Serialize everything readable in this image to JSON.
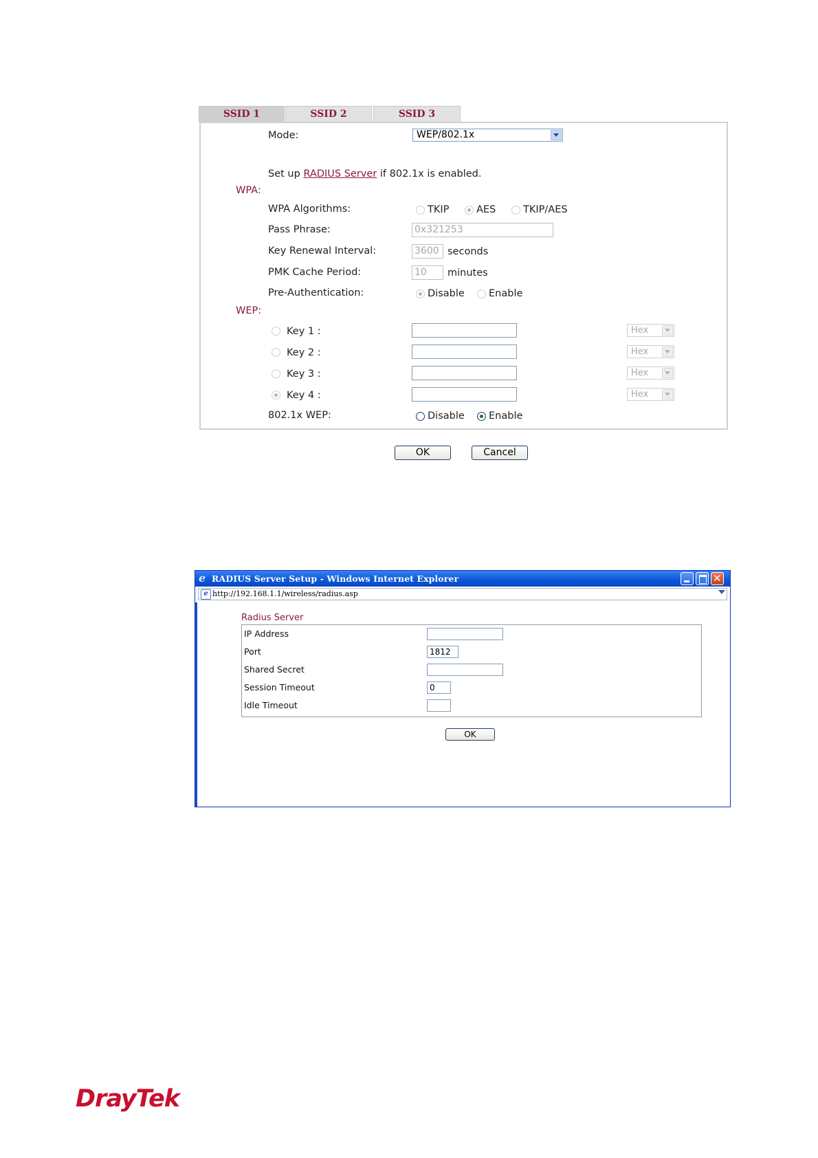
{
  "tabs": [
    {
      "label": "SSID 1"
    },
    {
      "label": "SSID 2"
    },
    {
      "label": "SSID 3"
    }
  ],
  "mode": {
    "label": "Mode:",
    "value": "WEP/802.1x"
  },
  "radius_note": {
    "prefix": "Set up",
    "link": "RADIUS Server",
    "suffix": "if 802.1x is enabled."
  },
  "wpa": {
    "title": "WPA:",
    "algorithms_label": "WPA Algorithms:",
    "algorithms": [
      "TKIP",
      "AES",
      "TKIP/AES"
    ],
    "algorithms_selected": "AES",
    "pass_phrase_label": "Pass Phrase:",
    "pass_phrase": "0x321253",
    "key_renewal_label": "Key Renewal Interval:",
    "key_renewal": "3600",
    "key_renewal_unit": "seconds",
    "pmk_label": "PMK Cache Period:",
    "pmk": "10",
    "pmk_unit": "minutes",
    "preauth_label": "Pre-Authentication:",
    "preauth_options": [
      "Disable",
      "Enable"
    ],
    "preauth_selected": "Disable"
  },
  "wep": {
    "title": "WEP:",
    "keys": [
      {
        "label": "Key 1 :",
        "value": "",
        "format": "Hex",
        "selected": false
      },
      {
        "label": "Key 2 :",
        "value": "",
        "format": "Hex",
        "selected": false
      },
      {
        "label": "Key 3 :",
        "value": "",
        "format": "Hex",
        "selected": false
      },
      {
        "label": "Key 4 :",
        "value": "",
        "format": "Hex",
        "selected": true
      }
    ],
    "x8021_label": "802.1x WEP:",
    "x8021_options": [
      "Disable",
      "Enable"
    ],
    "x8021_selected": "Enable"
  },
  "buttons": {
    "ok": "OK",
    "cancel": "Cancel"
  },
  "ie_window": {
    "title": "RADIUS Server Setup - Windows Internet Explorer",
    "address": "http://192.168.1.1/wireless/radius.asp",
    "section_title": "Radius Server",
    "fields": [
      {
        "label": "IP Address",
        "value": ""
      },
      {
        "label": "Port",
        "value": "1812"
      },
      {
        "label": "Shared Secret",
        "value": ""
      },
      {
        "label": "Session Timeout",
        "value": "0"
      },
      {
        "label": "Idle Timeout",
        "value": ""
      }
    ],
    "ok": "OK"
  },
  "logo": "DrayTek",
  "colors": {
    "accent": "#8b1a3c",
    "logo": "#c8102e",
    "titlebar": "#0a56d8"
  }
}
